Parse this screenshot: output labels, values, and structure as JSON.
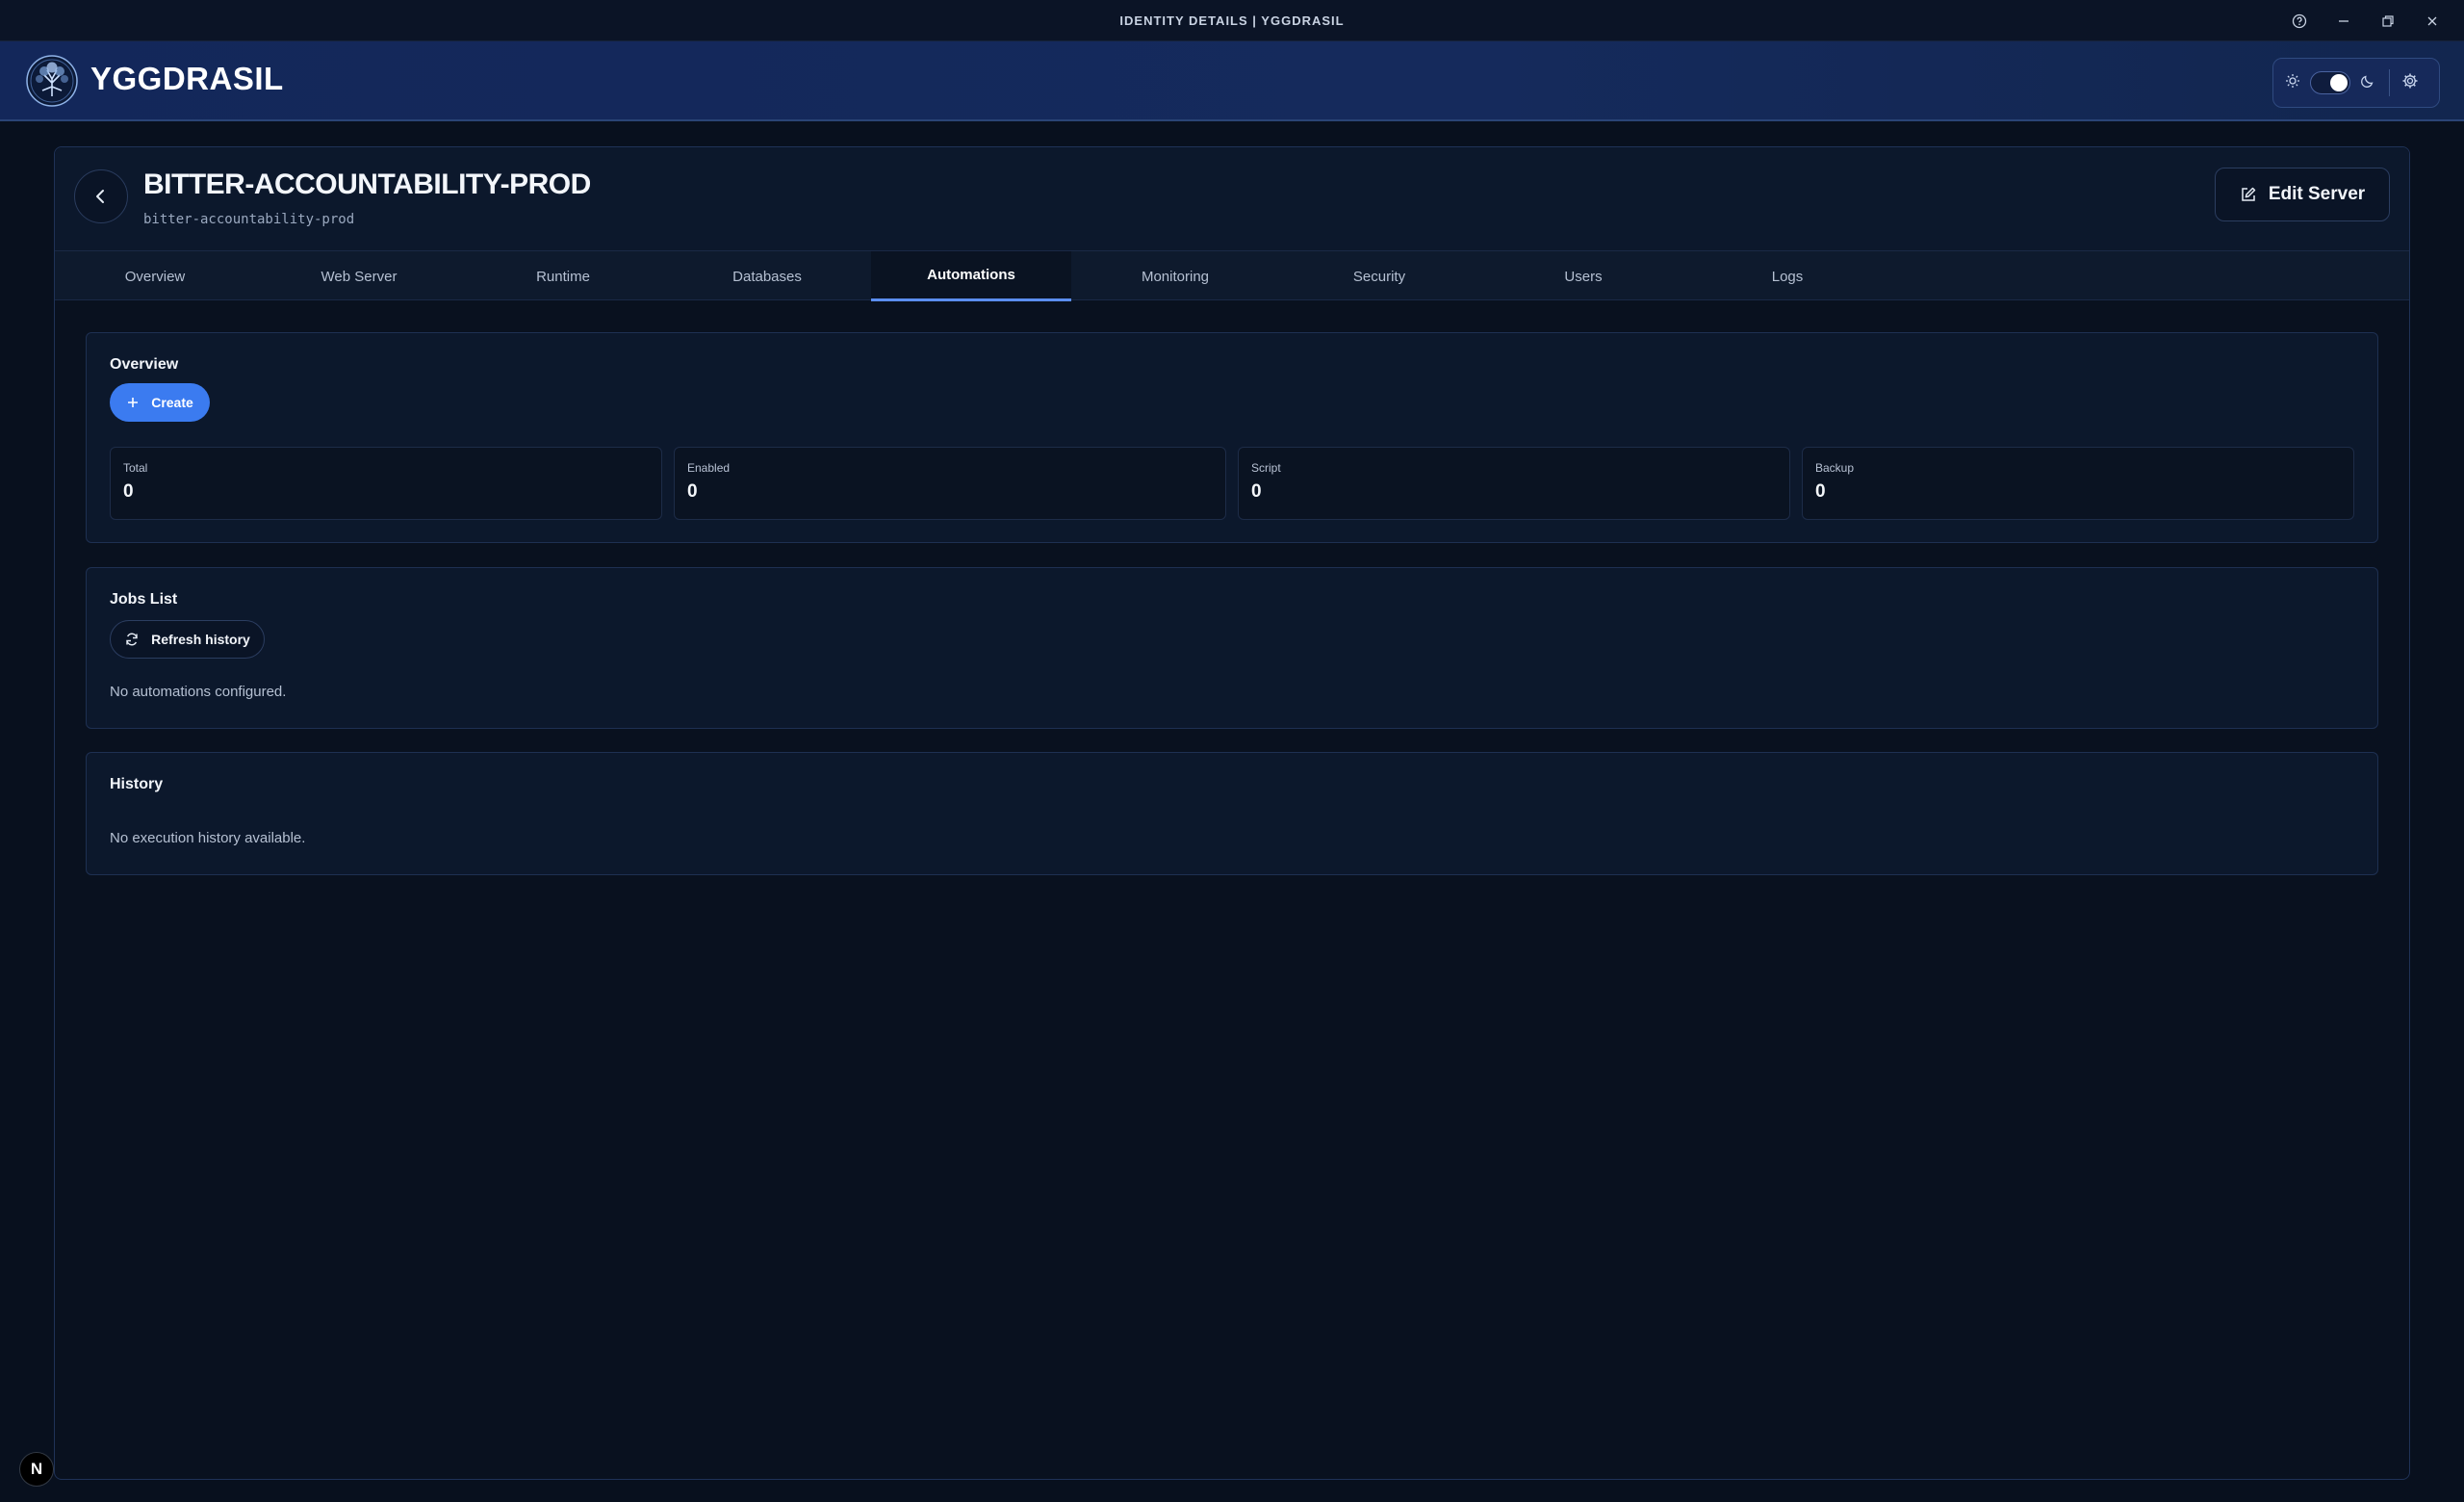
{
  "window": {
    "title": "IDENTITY DETAILS | YGGDRASIL",
    "controls": [
      "help-icon",
      "minimize-icon",
      "restore-icon",
      "close-icon"
    ]
  },
  "header": {
    "brand": "YGGDRASIL",
    "theme_toggle": {
      "state": "dark",
      "icons": [
        "sun-icon",
        "moon-icon",
        "gear-icon"
      ]
    }
  },
  "server": {
    "title": "BITTER-ACCOUNTABILITY-PROD",
    "slug": "bitter-accountability-prod",
    "edit_label": "Edit Server"
  },
  "tabs": [
    {
      "label": "Overview",
      "active": false
    },
    {
      "label": "Web Server",
      "active": false
    },
    {
      "label": "Runtime",
      "active": false
    },
    {
      "label": "Databases",
      "active": false
    },
    {
      "label": "Automations",
      "active": true
    },
    {
      "label": "Monitoring",
      "active": false
    },
    {
      "label": "Security",
      "active": false
    },
    {
      "label": "Users",
      "active": false
    },
    {
      "label": "Logs",
      "active": false
    }
  ],
  "overview": {
    "title": "Overview",
    "create_label": "Create",
    "stats": [
      {
        "label": "Total",
        "value": "0"
      },
      {
        "label": "Enabled",
        "value": "0"
      },
      {
        "label": "Script",
        "value": "0"
      },
      {
        "label": "Backup",
        "value": "0"
      }
    ]
  },
  "jobs": {
    "title": "Jobs List",
    "refresh_label": "Refresh history",
    "empty": "No automations configured."
  },
  "history": {
    "title": "History",
    "empty": "No execution history available."
  },
  "corner_badge": "N",
  "colors": {
    "accent": "#3b7bf0",
    "tab_underline": "#5b8ef0",
    "header_bg": "#13275a",
    "page_bg": "#08101e"
  }
}
